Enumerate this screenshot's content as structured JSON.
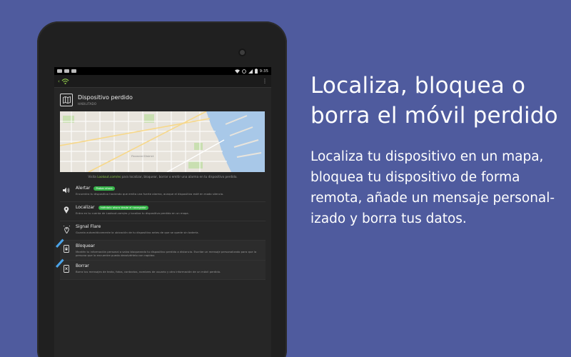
{
  "device": {
    "status_time": "9:35"
  },
  "app": {
    "back_glyph": "‹",
    "menu_glyph": "⋮",
    "section_title": "Dispositivo perdido",
    "section_status": "HABILITADO",
    "map_caption_prefix": "Visita ",
    "map_caption_link": "Lookout.com/es",
    "map_caption_suffix": " para localizar, bloquear, borrar o emitir una alarma en tu dispositivo perdido.",
    "map_label": "Financial District",
    "features": [
      {
        "title": "Alertar",
        "badge": "Probar ahora",
        "description": "Encuentra tu dispositivo haciendo que emita una fuerte alarma, aunque el dispositivo esté en modo silencio.",
        "icon": "speaker-icon"
      },
      {
        "title": "Localizar",
        "badge": "Inténtalo ahora desde el navegador",
        "description": "Entra en tu cuenta de Lookout.com/es y localiza tu dispositivo perdido en un mapa.",
        "icon": "location-pin-icon"
      },
      {
        "title": "Signal Flare",
        "badge": "",
        "description": "Guarda automáticamente la ubicación de tu dispositivo antes de que se quede sin batería.",
        "icon": "flare-icon"
      },
      {
        "title": "Bloquear",
        "badge": "",
        "description": "Mantén tu información personal a salvo bloqueando tu dispositivo perdido a distancia. Escribe un mensaje personalizado para que la persona que lo encuentre pueda devolvértelo con rapidez.",
        "icon": "lock-phone-icon"
      },
      {
        "title": "Borrar",
        "badge": "",
        "description": "Borra tus mensajes de texto, fotos, contactos, nombres de usuario y otra información de un móvil perdido.",
        "icon": "wipe-phone-icon"
      }
    ]
  },
  "marketing": {
    "headline_line1": "Localiza, bloquea o",
    "headline_line2": "borra el móvil perdido",
    "body_line1": "Localiza tu dispositivo en un mapa,",
    "body_line2": "bloquea tu dispositivo de forma",
    "body_line3": "remota, añade un mensaje personal-",
    "body_line4": "izado y borra tus datos."
  },
  "colors": {
    "background": "#4f5b9e",
    "accent_green": "#37b54a",
    "stripe_blue": "#4aa3e8"
  }
}
